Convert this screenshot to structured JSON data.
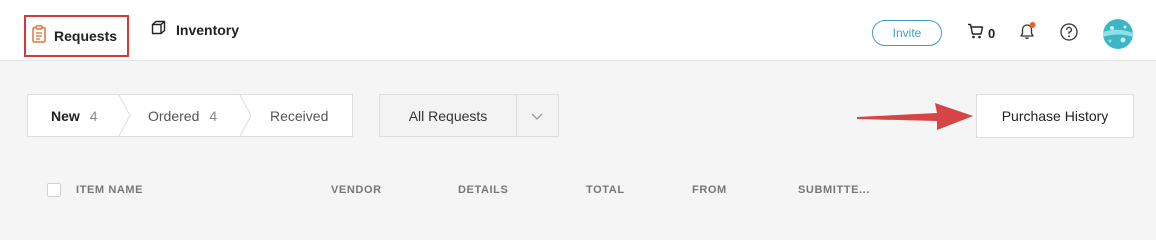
{
  "nav": {
    "requests_label": "Requests",
    "inventory_label": "Inventory"
  },
  "header": {
    "invite_label": "Invite",
    "cart_count": "0"
  },
  "tabs": [
    {
      "label": "New",
      "count": "4"
    },
    {
      "label": "Ordered",
      "count": "4"
    },
    {
      "label": "Received",
      "count": ""
    }
  ],
  "filter": {
    "selected": "All Requests"
  },
  "actions": {
    "purchase_history_label": "Purchase History"
  },
  "table": {
    "columns": [
      "ITEM NAME",
      "VENDOR",
      "DETAILS",
      "TOTAL",
      "FROM",
      "SUBMITTE..."
    ]
  },
  "colors": {
    "accent": "#3f9cc8",
    "highlight_border": "#d23a3a",
    "arrow": "#d64545",
    "notification_dot": "#e8622c",
    "requests_icon": "#e2733a"
  },
  "icons": {
    "requests": "clipboard-icon",
    "inventory": "box-icon",
    "cart": "cart-icon",
    "bell": "bell-icon",
    "help": "help-icon",
    "filter_chevron": "chevron-down-icon"
  }
}
